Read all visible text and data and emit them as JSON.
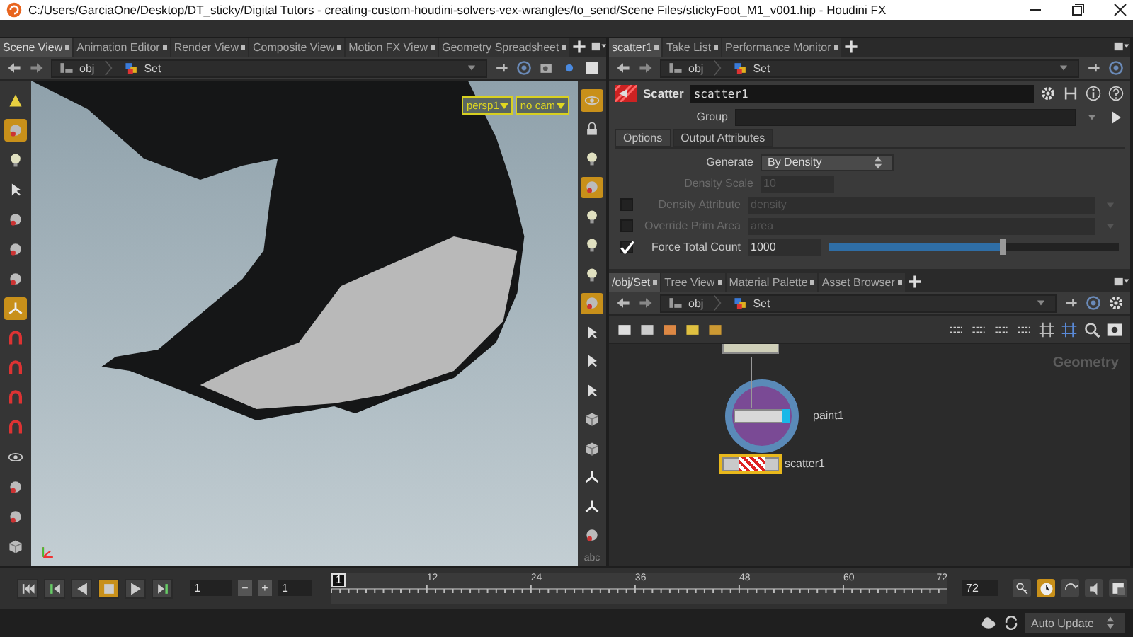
{
  "window": {
    "title": "C:/Users/GarciaOne/Desktop/DT_sticky/Digital Tutors - creating-custom-houdini-solvers-vex-wrangles/to_send/Scene Files/stickyFoot_M1_v001.hip - Houdini FX"
  },
  "viewer_pane": {
    "tabs": [
      {
        "label": "Scene View",
        "selected": true
      },
      {
        "label": "Animation Editor",
        "selected": false
      },
      {
        "label": "Render View",
        "selected": false
      },
      {
        "label": "Composite View",
        "selected": false
      },
      {
        "label": "Motion FX View",
        "selected": false
      },
      {
        "label": "Geometry Spreadsheet",
        "selected": false
      }
    ],
    "path": [
      "obj",
      "Set"
    ],
    "camera_menus": [
      "persp1",
      "no cam"
    ],
    "left_tools": [
      {
        "kind": "cone",
        "selected": false
      },
      {
        "kind": "sphere",
        "selected": true
      },
      {
        "kind": "bulb",
        "selected": false
      },
      {
        "kind": "arrow",
        "selected": false
      },
      {
        "kind": "sphere",
        "selected": false
      },
      {
        "kind": "sphere",
        "selected": false
      },
      {
        "kind": "sphere",
        "selected": false
      },
      {
        "kind": "axes",
        "selected": true
      },
      {
        "kind": "magnet",
        "selected": false
      },
      {
        "kind": "magnet",
        "selected": false
      },
      {
        "kind": "magnet",
        "selected": false
      },
      {
        "kind": "magnet",
        "selected": false
      },
      {
        "kind": "eye",
        "selected": false
      },
      {
        "kind": "sphere",
        "selected": false
      },
      {
        "kind": "sphere",
        "selected": false
      },
      {
        "kind": "cube",
        "selected": false
      }
    ],
    "right_tools": [
      {
        "kind": "eye",
        "selected": true
      },
      {
        "kind": "lock",
        "selected": false
      },
      {
        "kind": "bulb",
        "selected": false
      },
      {
        "kind": "sphere",
        "selected": true
      },
      {
        "kind": "bulb",
        "selected": false
      },
      {
        "kind": "bulb",
        "selected": false
      },
      {
        "kind": "bulb",
        "selected": false
      },
      {
        "kind": "sphere",
        "selected": true
      },
      {
        "kind": "arrow",
        "selected": false
      },
      {
        "kind": "arrow",
        "selected": false
      },
      {
        "kind": "arrow",
        "selected": false
      },
      {
        "kind": "cube",
        "selected": false
      },
      {
        "kind": "cube",
        "selected": false
      },
      {
        "kind": "axes",
        "selected": false
      },
      {
        "kind": "axes",
        "selected": false
      },
      {
        "kind": "sphere",
        "selected": false
      }
    ],
    "right_toolbar_label": "abc"
  },
  "parameter_pane": {
    "tabs": [
      {
        "label": "scatter1",
        "selected": true
      },
      {
        "label": "Take List",
        "selected": false
      },
      {
        "label": "Performance Monitor",
        "selected": false
      }
    ],
    "path": [
      "obj",
      "Set"
    ],
    "node_type": "Scatter",
    "node_name": "scatter1",
    "group_label": "Group",
    "folders": [
      {
        "label": "Options",
        "selected": true
      },
      {
        "label": "Output Attributes",
        "selected": false
      }
    ],
    "parameters": [
      {
        "kind": "menu",
        "label": "Generate",
        "value": "By Density",
        "disabled": false
      },
      {
        "kind": "number",
        "label": "Density Scale",
        "value": "10",
        "disabled": true
      },
      {
        "kind": "toggle_menu",
        "label": "Density Attribute",
        "value": "density",
        "checked": false,
        "disabled": true
      },
      {
        "kind": "toggle_menu",
        "label": "Override Prim Area",
        "value": "area",
        "checked": false,
        "disabled": true
      },
      {
        "kind": "toggle_slider",
        "label": "Force Total Count",
        "value": "1000",
        "checked": true,
        "disabled": false,
        "level": 0.6
      }
    ]
  },
  "network_pane": {
    "tabs": [
      {
        "label": "/obj/Set",
        "selected": true
      },
      {
        "label": "Tree View",
        "selected": false
      },
      {
        "label": "Material Palette",
        "selected": false
      },
      {
        "label": "Asset Browser",
        "selected": false
      }
    ],
    "path": [
      "obj",
      "Set"
    ],
    "context_label": "Geometry",
    "nodes": [
      {
        "kind": "generic",
        "selected": false,
        "display": false,
        "hovered": false
      },
      {
        "kind": "paint",
        "name": "paint1",
        "selected": false,
        "display": true,
        "hovered": true
      },
      {
        "kind": "scatter",
        "name": "scatter1",
        "selected": true,
        "display": false,
        "hovered": false
      }
    ]
  },
  "timeline": {
    "playback": [
      {
        "kind": "first",
        "selected": false
      },
      {
        "kind": "prev_key",
        "selected": false
      },
      {
        "kind": "reverse",
        "selected": false
      },
      {
        "kind": "stop",
        "selected": true
      },
      {
        "kind": "play",
        "selected": false
      },
      {
        "kind": "next_key",
        "selected": false
      }
    ],
    "current_frame_field": "1",
    "step_buttons": [
      "−",
      "+"
    ],
    "start_frame": "1",
    "current_frame": "1",
    "frame_labels": [
      "12",
      "24",
      "36",
      "48",
      "60",
      "72"
    ],
    "end_frame": "72",
    "realtime_on": true
  },
  "status_bar": {
    "update_mode": "Auto Update"
  }
}
